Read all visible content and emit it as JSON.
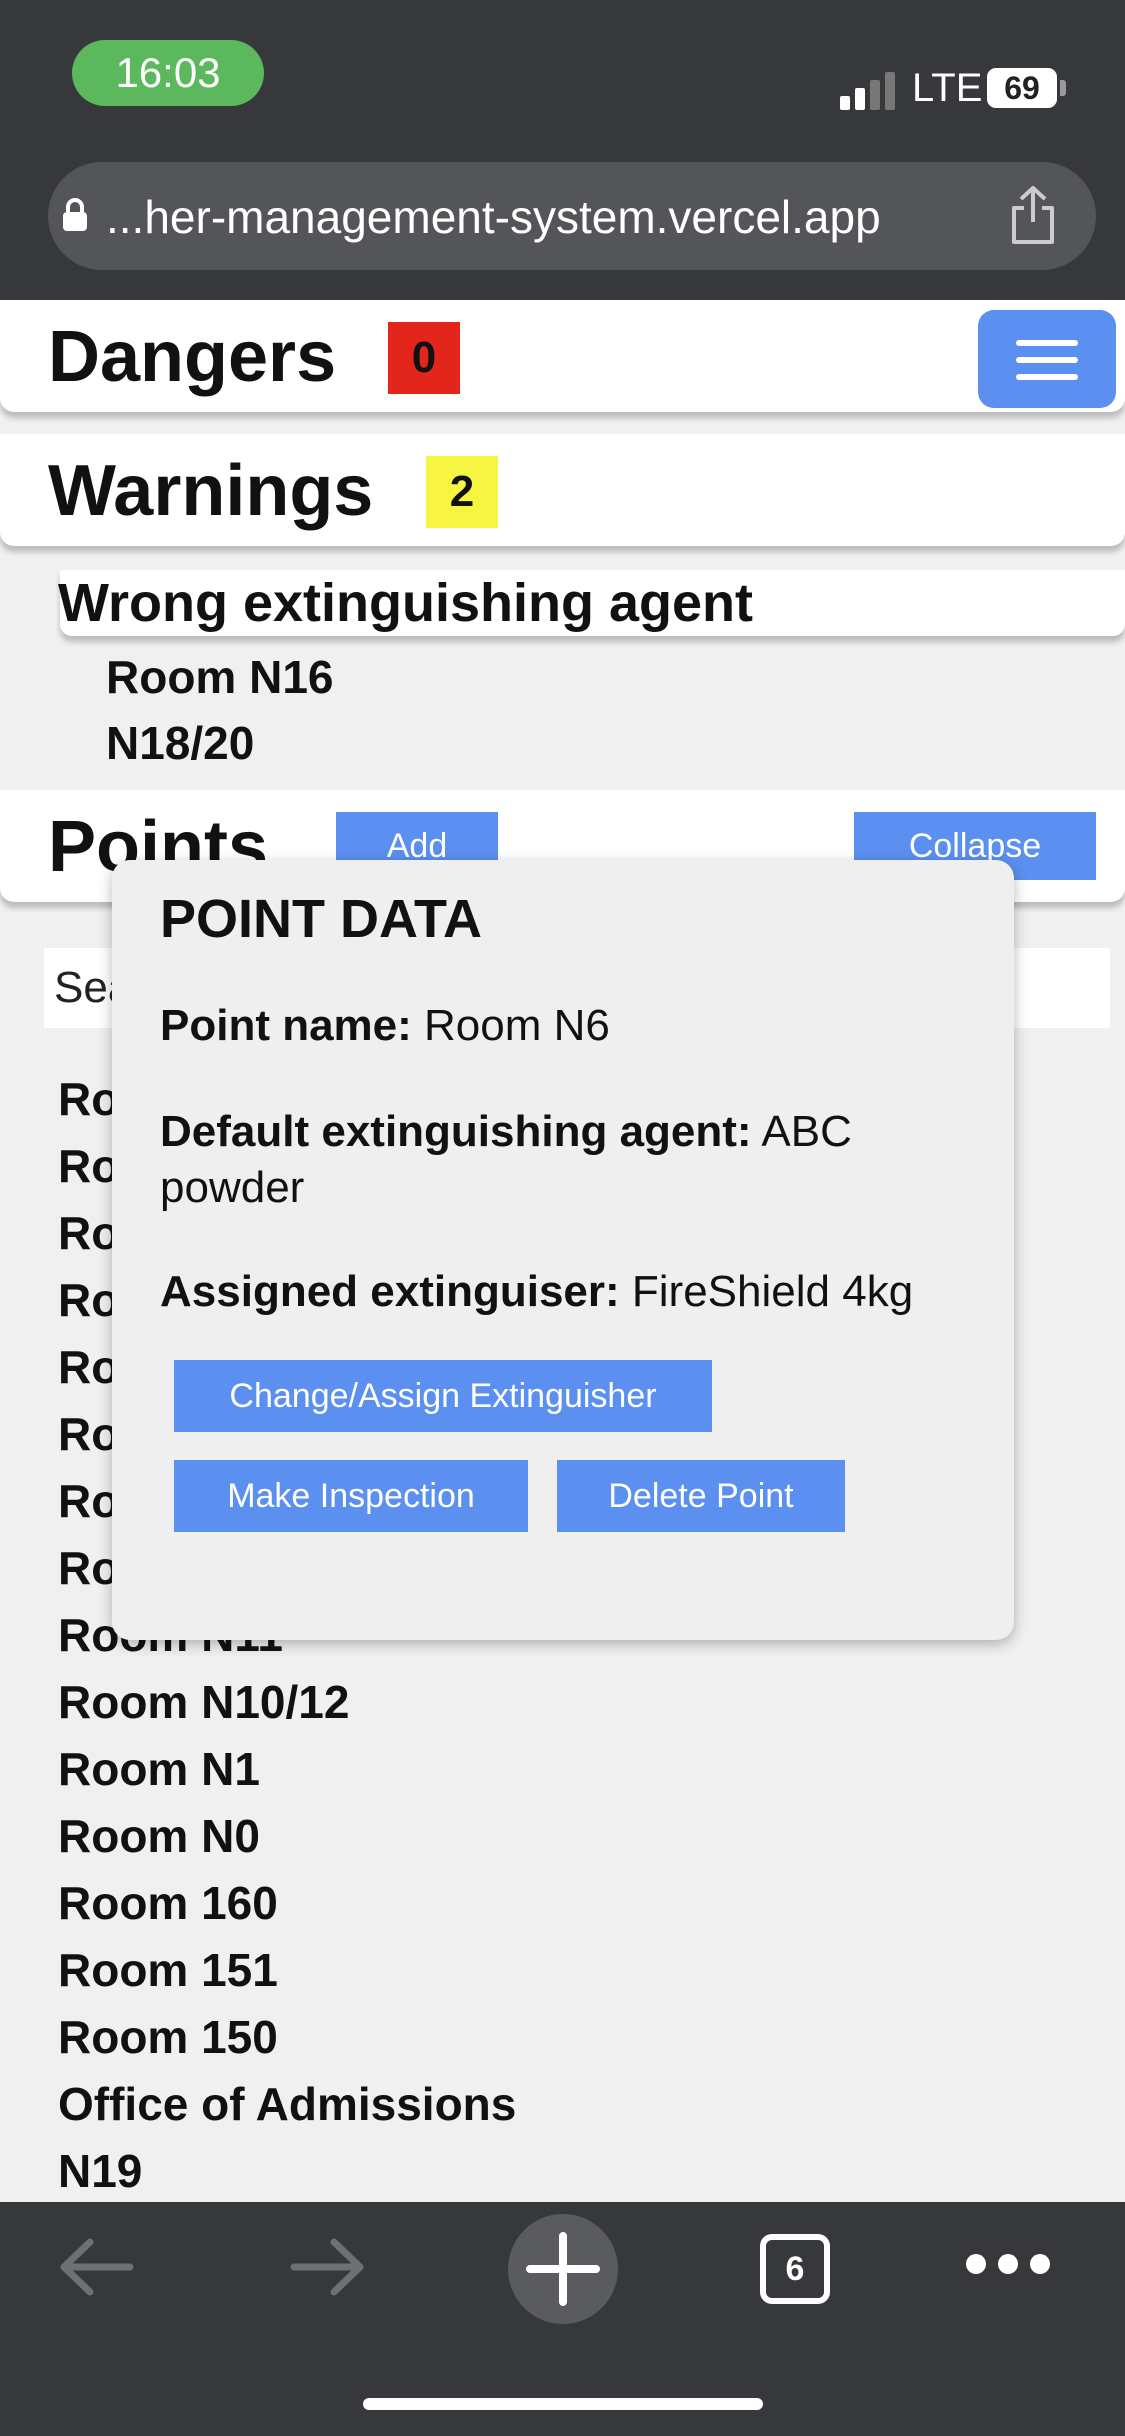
{
  "status_bar": {
    "time": "16:03",
    "network": "LTE",
    "battery": "69"
  },
  "browser": {
    "url": "...her-management-system.vercel.app",
    "tab_count": "6"
  },
  "dangers": {
    "title": "Dangers",
    "count": "0",
    "badge_color": "#e3261c"
  },
  "warnings": {
    "title": "Warnings",
    "count": "2",
    "badge_color": "#f5f542",
    "group_title": "Wrong extinguishing agent",
    "items": [
      "Room N16",
      "N18/20"
    ]
  },
  "points": {
    "title": "Points",
    "add_label": "Add",
    "collapse_label": "Collapse",
    "search_placeholder": "Sea",
    "items_partial": [
      "Ro",
      "Ro",
      "Ro",
      "Ro",
      "Ro",
      "Ro",
      "Ro",
      "Ro",
      "Room N11"
    ],
    "items": [
      "Room N10/12",
      "Room N1",
      "Room N0",
      "Room 160",
      "Room 151",
      "Room 150",
      "Office of Admissions",
      "N19"
    ]
  },
  "modal": {
    "title": "POINT DATA",
    "point_name_label": "Point name:",
    "point_name": "Room N6",
    "agent_label": "Default extinguishing agent:",
    "agent": "ABC powder",
    "extinguisher_label": "Assigned extinguiser:",
    "extinguisher": "FireShield 4kg",
    "change_button": "Change/Assign Extinguisher",
    "inspect_button": "Make Inspection",
    "delete_button": "Delete Point"
  },
  "accent_color": "#5b8ff0"
}
